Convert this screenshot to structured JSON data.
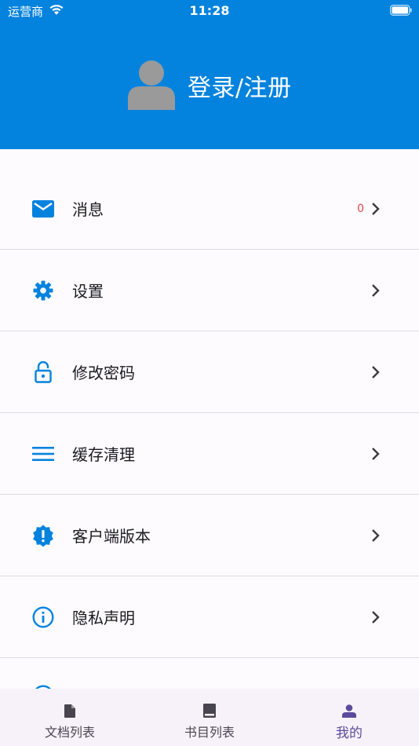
{
  "status_bar": {
    "carrier": "运营商",
    "time": "11:28"
  },
  "header": {
    "login_label": "登录/注册",
    "background_color": "#0483de"
  },
  "menu": {
    "items": [
      {
        "label": "消息",
        "icon": "mail-icon",
        "badge": "0"
      },
      {
        "label": "设置",
        "icon": "gear-icon"
      },
      {
        "label": "修改密码",
        "icon": "lock-icon"
      },
      {
        "label": "缓存清理",
        "icon": "menu-lines-icon"
      },
      {
        "label": "客户端版本",
        "icon": "alert-badge-icon"
      },
      {
        "label": "隐私声明",
        "icon": "info-icon"
      }
    ]
  },
  "tabbar": {
    "tabs": [
      {
        "label": "文档列表",
        "icon": "document-icon"
      },
      {
        "label": "书目列表",
        "icon": "book-icon"
      },
      {
        "label": "我的",
        "icon": "person-icon",
        "active": true
      }
    ]
  },
  "colors": {
    "accent": "#0483de",
    "active_tab": "#5d4a9c",
    "badge": "#e24848"
  }
}
